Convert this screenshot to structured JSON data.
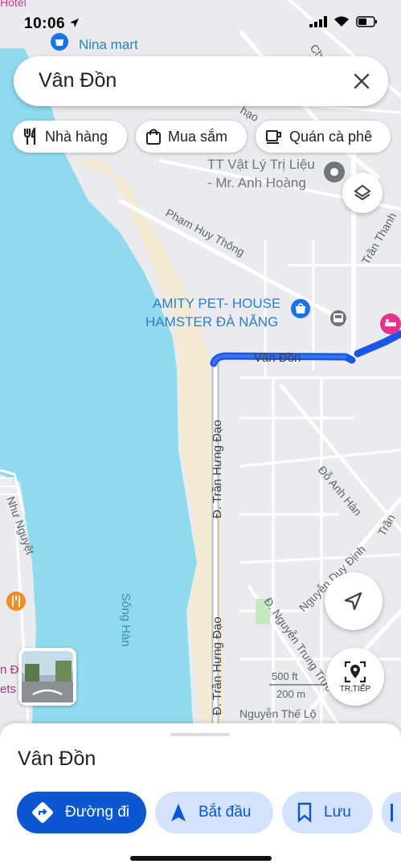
{
  "status_bar": {
    "time": "10:06"
  },
  "search": {
    "query": "Vân Đồn"
  },
  "chips": [
    {
      "label": "Nhà hàng",
      "icon": "restaurant-icon"
    },
    {
      "label": "Mua sắm",
      "icon": "shopping-bag-icon"
    },
    {
      "label": "Quán cà phê",
      "icon": "coffee-icon"
    }
  ],
  "map": {
    "top_label": "Hotel",
    "pois": {
      "nina_mart": "Nina mart",
      "physio_line1": "TT Vật Lý Trị Liệu",
      "physio_line2": "- Mr. Anh Hoàng",
      "amity_line1": "AMITY PET- HOUSE",
      "amity_line2": "HAMSTER ĐÀ NẴNG"
    },
    "streets": {
      "pham_huy_thong": "Phạm Huy Thông",
      "van_don": "Vân Đồn",
      "tran_hung_dao_1": "Đ. Trần Hưng Đạo",
      "tran_hung_dao_2": "Đ. Trần Hưng Đạo",
      "do_anh_han": "Đỗ Anh Hàn",
      "nguyen_trung_truc": "Đ. Nguyễn Trung Trực",
      "nguyen_the_lo": "Nguyễn Thế Lộ",
      "nguyen_duy_dinh": "Nguyễn Duy Định",
      "nhu_nguyet": "Như Nguyệt",
      "tran_thanh": "Trần Thanh",
      "tran_top": "Trần",
      "chu": "Chu",
      "hao": "hạo",
      "song_han": "Sông Hàn",
      "left_d": "n Đ",
      "left_ets": "ets"
    },
    "scale": {
      "top": "500 ft",
      "bottom": "200 m"
    }
  },
  "controls": {
    "next_label": "TR.TIẾP"
  },
  "sheet": {
    "title": "Vân Đồn",
    "actions": {
      "directions": "Đường đi",
      "start": "Bắt đầu",
      "save": "Lưu"
    }
  },
  "colors": {
    "accent": "#0b57d0",
    "water": "#90daee",
    "route": "#1a57e8",
    "pin_pink": "#e8338a"
  }
}
